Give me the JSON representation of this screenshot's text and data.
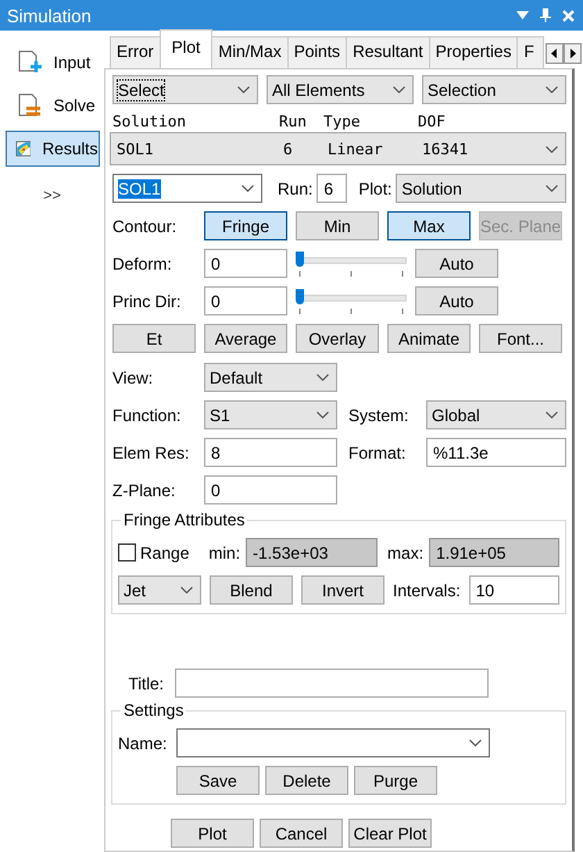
{
  "window": {
    "title": "Simulation"
  },
  "sidebar": {
    "items": [
      {
        "label": "Input",
        "kind": "input",
        "selected": false
      },
      {
        "label": "Solve",
        "kind": "solve",
        "selected": false
      },
      {
        "label": "Results",
        "kind": "results",
        "selected": true
      }
    ],
    "expand": ">>"
  },
  "tabs": [
    {
      "label": "Error",
      "selected": false
    },
    {
      "label": "Plot",
      "selected": true
    },
    {
      "label": "Min/Max",
      "selected": false
    },
    {
      "label": "Points",
      "selected": false
    },
    {
      "label": "Resultant",
      "selected": false
    },
    {
      "label": "Properties",
      "selected": false
    },
    {
      "label": "F",
      "selected": false
    }
  ],
  "filters": [
    "Select",
    "All Elements",
    "Selection"
  ],
  "solution_table": {
    "columns": [
      "Solution",
      "Run",
      "Type",
      "DOF"
    ],
    "row": [
      "SOL1",
      "6",
      "Linear",
      "16341"
    ]
  },
  "solution_select": {
    "value": "SOL1",
    "run_label": "Run:",
    "run": "6",
    "plot_label": "Plot:",
    "plot": "Solution"
  },
  "contour": {
    "label": "Contour:",
    "buttons": [
      {
        "label": "Fringe",
        "active": true,
        "disabled": false
      },
      {
        "label": "Min",
        "active": false,
        "disabled": false
      },
      {
        "label": "Max",
        "active": true,
        "disabled": false
      },
      {
        "label": "Sec. Plane",
        "active": false,
        "disabled": true
      }
    ]
  },
  "sliders": [
    {
      "label": "Deform:",
      "value": "0",
      "level": 0,
      "button": "Auto"
    },
    {
      "label": "Princ Dir:",
      "value": "0",
      "level": 0,
      "button": "Auto"
    }
  ],
  "actions": [
    "Et",
    "Average",
    "Overlay",
    "Animate",
    "Font..."
  ],
  "view": {
    "label": "View:",
    "value": "Default"
  },
  "function": {
    "label": "Function:",
    "value": "S1",
    "system_label": "System:",
    "system": "Global"
  },
  "elem_res": {
    "label": "Elem Res:",
    "value": "8",
    "format_label": "Format:",
    "format": "%11.3e"
  },
  "z_plane": {
    "label": "Z-Plane:",
    "value": "0"
  },
  "fringe": {
    "title": "Fringe Attributes",
    "range": {
      "label": "Range",
      "checked": false
    },
    "min_label": "min:",
    "min": "-1.53e+03",
    "max_label": "max:",
    "max": "1.91e+05",
    "colormap": "Jet",
    "blend": "Blend",
    "invert": "Invert",
    "intervals_label": "Intervals:",
    "intervals": "10"
  },
  "title_label": "Title:",
  "settings": {
    "title": "Settings",
    "name_label": "Name:",
    "buttons": [
      "Save",
      "Delete",
      "Purge"
    ]
  },
  "bottom_buttons": [
    "Plot",
    "Cancel",
    "Clear Plot"
  ]
}
